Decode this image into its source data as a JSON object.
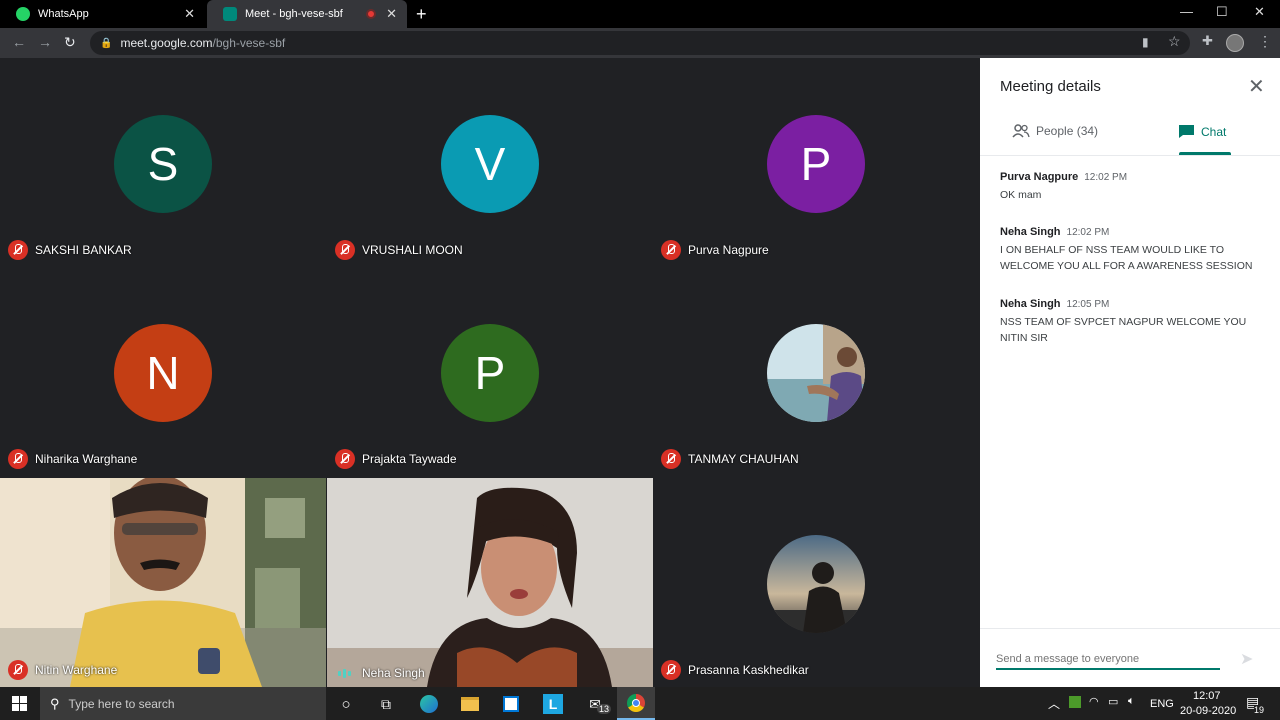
{
  "browser": {
    "tabs": [
      {
        "title": "WhatsApp",
        "active": false,
        "icon": "whatsapp-icon",
        "color": "#25d366"
      },
      {
        "title": "Meet - bgh-vese-sbf",
        "active": true,
        "icon": "meet-icon",
        "color": "#00897b"
      }
    ],
    "new_tab_glyph": "+",
    "url_host": "meet.google.com",
    "url_path": "/bgh-vese-sbf"
  },
  "participants": [
    {
      "name": "SAKSHI BANKAR",
      "initial": "S",
      "color": "#0b5345",
      "muted": true
    },
    {
      "name": "VRUSHALI MOON",
      "initial": "V",
      "color": "#0a9bb3",
      "muted": true
    },
    {
      "name": "Purva Nagpure",
      "initial": "P",
      "color": "#7b1fa2",
      "muted": true
    },
    {
      "name": "Niharika Warghane",
      "initial": "N",
      "color": "#c43e14",
      "muted": true
    },
    {
      "name": "Prajakta Taywade",
      "initial": "P",
      "color": "#2e6b1f",
      "muted": true
    },
    {
      "name": "TANMAY CHAUHAN",
      "initial": "",
      "color": "",
      "muted": true
    },
    {
      "name": "Nitin Warghane",
      "initial": "",
      "color": "",
      "muted": true
    },
    {
      "name": "Neha Singh",
      "initial": "",
      "color": "",
      "muted": false
    },
    {
      "name": "Prasanna Kaskhedikar",
      "initial": "",
      "color": "",
      "muted": true
    }
  ],
  "panel": {
    "title": "Meeting details",
    "people_tab": "People (34)",
    "chat_tab": "Chat",
    "accent": "#00796b",
    "messages": [
      {
        "sender": "Purva Nagpure",
        "time": "12:02 PM",
        "text": "OK mam"
      },
      {
        "sender": "Neha Singh",
        "time": "12:02 PM",
        "text": "I ON BEHALF OF NSS TEAM WOULD LIKE TO WELCOME YOU ALL FOR A AWARENESS SESSION"
      },
      {
        "sender": "Neha Singh",
        "time": "12:05 PM",
        "text": "NSS TEAM OF SVPCET NAGPUR WELCOME YOU NITIN SIR"
      }
    ],
    "input_placeholder": "Send a message to everyone"
  },
  "taskbar": {
    "search_placeholder": "Type here to search",
    "mail_badge": "13",
    "language": "ENG",
    "time": "12:07",
    "date": "20-09-2020",
    "notification_count": "19"
  }
}
